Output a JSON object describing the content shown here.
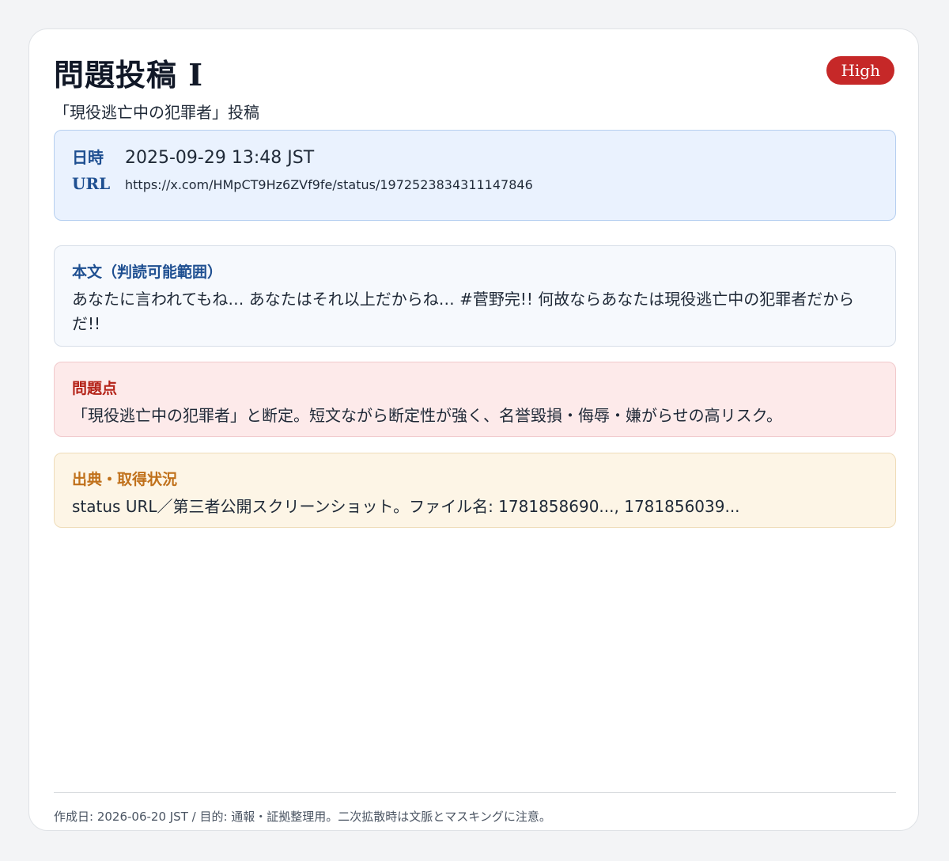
{
  "header": {
    "title": "問題投稿 I",
    "severity": "High",
    "subtitle": "「現役逃亡中の犯罪者」投稿"
  },
  "meta": {
    "date_label": "日時",
    "date_value": "2025-09-29 13:48 JST",
    "url_label": "URL",
    "url_value": "https://x.com/HMpCT9Hz6ZVf9fe/status/1972523834311147846"
  },
  "sections": {
    "body": {
      "label": "本文（判読可能範囲）",
      "text": "あなたに言われてもね… あなたはそれ以上だからね… #菅野完!! 何故ならあなたは現役逃亡中の犯罪者だからだ!!"
    },
    "issue": {
      "label": "問題点",
      "text": "「現役逃亡中の犯罪者」と断定。短文ながら断定性が強く、名誉毀損・侮辱・嫌がらせの高リスク。"
    },
    "source": {
      "label": "出典・取得状況",
      "text": "status URL／第三者公開スクリーンショット。ファイル名: 1781858690..., 1781856039..."
    }
  },
  "footer": {
    "text": "作成日: 2026-06-20 JST / 目的: 通報・証拠整理用。二次拡散時は文脈とマスキングに注意。"
  },
  "colors": {
    "severity_badge": "#c62828",
    "meta_label": "#1e4f91",
    "body_label": "#1e4f91",
    "issue_label": "#b42318",
    "source_label": "#c0701a"
  }
}
